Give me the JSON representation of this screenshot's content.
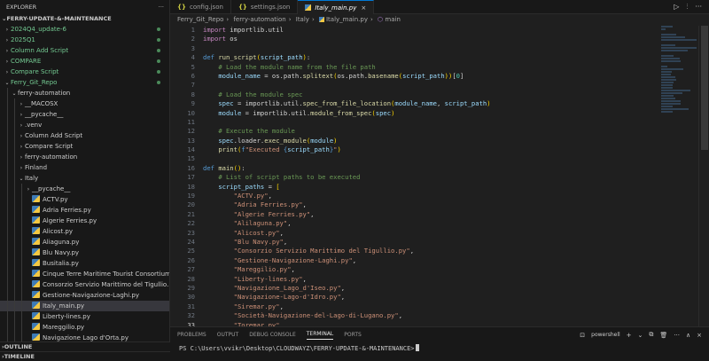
{
  "sidebar": {
    "title": "EXPLORER",
    "more_label": "···",
    "root": "FERRY-UPDATE-&-MAINTENANCE",
    "outline": "OUTLINE",
    "timeline": "TIMELINE"
  },
  "tree": [
    {
      "label": "2024Q4_update-6",
      "depth": 0,
      "type": "folder",
      "open": false,
      "green": true,
      "dot": true
    },
    {
      "label": "2025Q1",
      "depth": 0,
      "type": "folder",
      "open": false,
      "green": true,
      "dot": true
    },
    {
      "label": "Column Add Script",
      "depth": 0,
      "type": "folder",
      "open": false,
      "green": true,
      "dot": true
    },
    {
      "label": "COMPARE",
      "depth": 0,
      "type": "folder",
      "open": false,
      "green": true,
      "dot": true
    },
    {
      "label": "Compare Script",
      "depth": 0,
      "type": "folder",
      "open": false,
      "green": true,
      "dot": true
    },
    {
      "label": "Ferry_Git_Repo",
      "depth": 0,
      "type": "folder",
      "open": true,
      "green": true,
      "dot": true
    },
    {
      "label": "ferry-automation",
      "depth": 1,
      "type": "folder",
      "open": true
    },
    {
      "label": "__MACOSX",
      "depth": 2,
      "type": "folder",
      "open": false
    },
    {
      "label": "__pycache__",
      "depth": 2,
      "type": "folder",
      "open": false
    },
    {
      "label": ".venv",
      "depth": 2,
      "type": "folder",
      "open": false
    },
    {
      "label": "Column Add Script",
      "depth": 2,
      "type": "folder",
      "open": false
    },
    {
      "label": "Compare Script",
      "depth": 2,
      "type": "folder",
      "open": false
    },
    {
      "label": "ferry-automation",
      "depth": 2,
      "type": "folder",
      "open": false
    },
    {
      "label": "Finland",
      "depth": 2,
      "type": "folder",
      "open": false
    },
    {
      "label": "Italy",
      "depth": 2,
      "type": "folder",
      "open": true
    },
    {
      "label": "__pycache__",
      "depth": 3,
      "type": "folder",
      "open": false
    },
    {
      "label": "ACTV.py",
      "depth": 3,
      "type": "py"
    },
    {
      "label": "Adria Ferries.py",
      "depth": 3,
      "type": "py"
    },
    {
      "label": "Algerie Ferries.py",
      "depth": 3,
      "type": "py"
    },
    {
      "label": "Alicost.py",
      "depth": 3,
      "type": "py"
    },
    {
      "label": "Aliaguna.py",
      "depth": 3,
      "type": "py"
    },
    {
      "label": "Blu Navy.py",
      "depth": 3,
      "type": "py"
    },
    {
      "label": "Busitalia.py",
      "depth": 3,
      "type": "py"
    },
    {
      "label": "Cinque Terre Maritime Tourist Consortium - Gulf of...",
      "depth": 3,
      "type": "py"
    },
    {
      "label": "Consorzio Servizio Marittimo del Tigullio.py",
      "depth": 3,
      "type": "py"
    },
    {
      "label": "Gestione-Navigazione-Laghi.py",
      "depth": 3,
      "type": "py"
    },
    {
      "label": "Italy_main.py",
      "depth": 3,
      "type": "py",
      "selected": true
    },
    {
      "label": "Liberty-lines.py",
      "depth": 3,
      "type": "py"
    },
    {
      "label": "Mareggilio.py",
      "depth": 3,
      "type": "py"
    },
    {
      "label": "Navigazione Lago d'Orta.py",
      "depth": 3,
      "type": "py"
    }
  ],
  "tabs": [
    {
      "label": "config.json",
      "icon": "json-icon",
      "active": false
    },
    {
      "label": "settings.json",
      "icon": "json-icon",
      "active": false
    },
    {
      "label": "Italy_main.py",
      "icon": "python-icon",
      "active": true,
      "close": "×"
    }
  ],
  "tab_actions": [
    "▷",
    "⫶",
    "···"
  ],
  "breadcrumb": [
    "Ferry_Git_Repo",
    "ferry-automation",
    "Italy",
    "Italy_main.py",
    "main"
  ],
  "code": {
    "start_line": 1,
    "current_line": 33,
    "lines": [
      [
        [
          "k",
          "import"
        ],
        [
          "t",
          " importlib.util"
        ]
      ],
      [
        [
          "k",
          "import"
        ],
        [
          "t",
          " os"
        ]
      ],
      [],
      [
        [
          "d",
          "def"
        ],
        [
          "t",
          " "
        ],
        [
          "f",
          "run_script"
        ],
        [
          "p",
          "("
        ],
        [
          "v",
          "script_path"
        ],
        [
          "p",
          ")"
        ],
        [
          "t",
          ":"
        ]
      ],
      [
        [
          "t",
          "    "
        ],
        [
          "c",
          "# Load the module name from the file path"
        ]
      ],
      [
        [
          "t",
          "    "
        ],
        [
          "v",
          "module_name"
        ],
        [
          "t",
          " = os.path."
        ],
        [
          "f",
          "splitext"
        ],
        [
          "p",
          "("
        ],
        [
          "t",
          "os.path."
        ],
        [
          "f",
          "basename"
        ],
        [
          "p",
          "("
        ],
        [
          "v",
          "script_path"
        ],
        [
          "p",
          "))"
        ],
        [
          "t",
          "["
        ],
        [
          "n",
          "0"
        ],
        [
          "t",
          "]"
        ]
      ],
      [],
      [
        [
          "t",
          "    "
        ],
        [
          "c",
          "# Load the module spec"
        ]
      ],
      [
        [
          "t",
          "    "
        ],
        [
          "v",
          "spec"
        ],
        [
          "t",
          " = importlib.util."
        ],
        [
          "f",
          "spec_from_file_location"
        ],
        [
          "p",
          "("
        ],
        [
          "v",
          "module_name"
        ],
        [
          "t",
          ", "
        ],
        [
          "v",
          "script_path"
        ],
        [
          "p",
          ")"
        ]
      ],
      [
        [
          "t",
          "    "
        ],
        [
          "v",
          "module"
        ],
        [
          "t",
          " = importlib.util."
        ],
        [
          "f",
          "module_from_spec"
        ],
        [
          "p",
          "("
        ],
        [
          "v",
          "spec"
        ],
        [
          "p",
          ")"
        ]
      ],
      [],
      [
        [
          "t",
          "    "
        ],
        [
          "c",
          "# Execute the module"
        ]
      ],
      [
        [
          "t",
          "    "
        ],
        [
          "v",
          "spec"
        ],
        [
          "t",
          ".loader."
        ],
        [
          "f",
          "exec_module"
        ],
        [
          "p",
          "("
        ],
        [
          "v",
          "module"
        ],
        [
          "p",
          ")"
        ]
      ],
      [
        [
          "t",
          "    "
        ],
        [
          "f",
          "print"
        ],
        [
          "p",
          "("
        ],
        [
          "d",
          "f"
        ],
        [
          "s",
          "\"Executed "
        ],
        [
          "d",
          "{"
        ],
        [
          "v",
          "script_path"
        ],
        [
          "d",
          "}"
        ],
        [
          "s",
          "\""
        ],
        [
          "p",
          ")"
        ]
      ],
      [],
      [
        [
          "d",
          "def"
        ],
        [
          "t",
          " "
        ],
        [
          "f",
          "main"
        ],
        [
          "p",
          "()"
        ],
        [
          "t",
          ":"
        ]
      ],
      [
        [
          "t",
          "    "
        ],
        [
          "c",
          "# List of script paths to be executed"
        ]
      ],
      [
        [
          "t",
          "    "
        ],
        [
          "v",
          "script_paths"
        ],
        [
          "t",
          " = "
        ],
        [
          "p",
          "["
        ]
      ],
      [
        [
          "t",
          "        "
        ],
        [
          "s",
          "\"ACTV.py\""
        ],
        [
          "t",
          ","
        ]
      ],
      [
        [
          "t",
          "        "
        ],
        [
          "s",
          "\"Adria Ferries.py\""
        ],
        [
          "t",
          ","
        ]
      ],
      [
        [
          "t",
          "        "
        ],
        [
          "s",
          "\"Algerie Ferries.py\""
        ],
        [
          "t",
          ","
        ]
      ],
      [
        [
          "t",
          "        "
        ],
        [
          "s",
          "\"Alilaguna.py\""
        ],
        [
          "t",
          ","
        ]
      ],
      [
        [
          "t",
          "        "
        ],
        [
          "s",
          "\"Alicost.py\""
        ],
        [
          "t",
          ","
        ]
      ],
      [
        [
          "t",
          "        "
        ],
        [
          "s",
          "\"Blu Navy.py\""
        ],
        [
          "t",
          ","
        ]
      ],
      [
        [
          "t",
          "        "
        ],
        [
          "s",
          "\"Consorzio Servizio Marittimo del Tigullio.py\""
        ],
        [
          "t",
          ","
        ]
      ],
      [
        [
          "t",
          "        "
        ],
        [
          "s",
          "\"Gestione-Navigazione-Laghi.py\""
        ],
        [
          "t",
          ","
        ]
      ],
      [
        [
          "t",
          "        "
        ],
        [
          "s",
          "\"Mareggilio.py\""
        ],
        [
          "t",
          ","
        ]
      ],
      [
        [
          "t",
          "        "
        ],
        [
          "s",
          "\"Liberty-lines.py\""
        ],
        [
          "t",
          ","
        ]
      ],
      [
        [
          "t",
          "        "
        ],
        [
          "s",
          "\"Navigazione_Lago_d'Iseo.py\""
        ],
        [
          "t",
          ","
        ]
      ],
      [
        [
          "t",
          "        "
        ],
        [
          "s",
          "\"Navigazione-Lago-d'Idro.py\""
        ],
        [
          "t",
          ","
        ]
      ],
      [
        [
          "t",
          "        "
        ],
        [
          "s",
          "\"Siremar.py\""
        ],
        [
          "t",
          ","
        ]
      ],
      [
        [
          "t",
          "        "
        ],
        [
          "s",
          "\"Società-Navigazione-del-Lago-di-Lugano.py\""
        ],
        [
          "t",
          ","
        ]
      ],
      [
        [
          "t",
          "        "
        ],
        [
          "s",
          "\"Toremar.py\""
        ],
        [
          "t",
          ","
        ]
      ]
    ]
  },
  "panel": {
    "tabs": [
      "PROBLEMS",
      "OUTPUT",
      "DEBUG CONSOLE",
      "TERMINAL",
      "PORTS"
    ],
    "active_tab": "TERMINAL",
    "shell": "powershell",
    "actions": [
      "+",
      "⌄",
      "⧉",
      "🗑",
      "···",
      "∧",
      "×"
    ],
    "prompt": "PS C:\\Users\\vvikr\\Desktop\\CLOUDWAYZ\\FERRY-UPDATE-&-MAINTENANCE>"
  },
  "colors": {
    "accent": "#0078d4",
    "git_green": "#73c991",
    "selection": "#37373d"
  }
}
